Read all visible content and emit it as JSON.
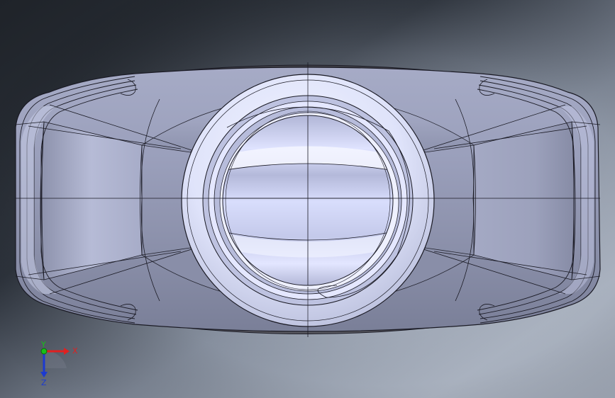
{
  "viewport": {
    "background_colors": [
      "#23272e",
      "#6c7584",
      "#aab3c1",
      "#a4acb9"
    ],
    "model": {
      "name": "bottle-top-view",
      "body_color": "#8e93ad",
      "face_color": "#c9cff0",
      "edge_color": "#1a1a24",
      "recess_color": "#4b4b52"
    }
  },
  "triad": {
    "x_label": "X",
    "y_label": "Y",
    "z_label": "Z",
    "x_color": "#e02020",
    "y_color": "#18c018",
    "z_color": "#1c3ad0"
  }
}
